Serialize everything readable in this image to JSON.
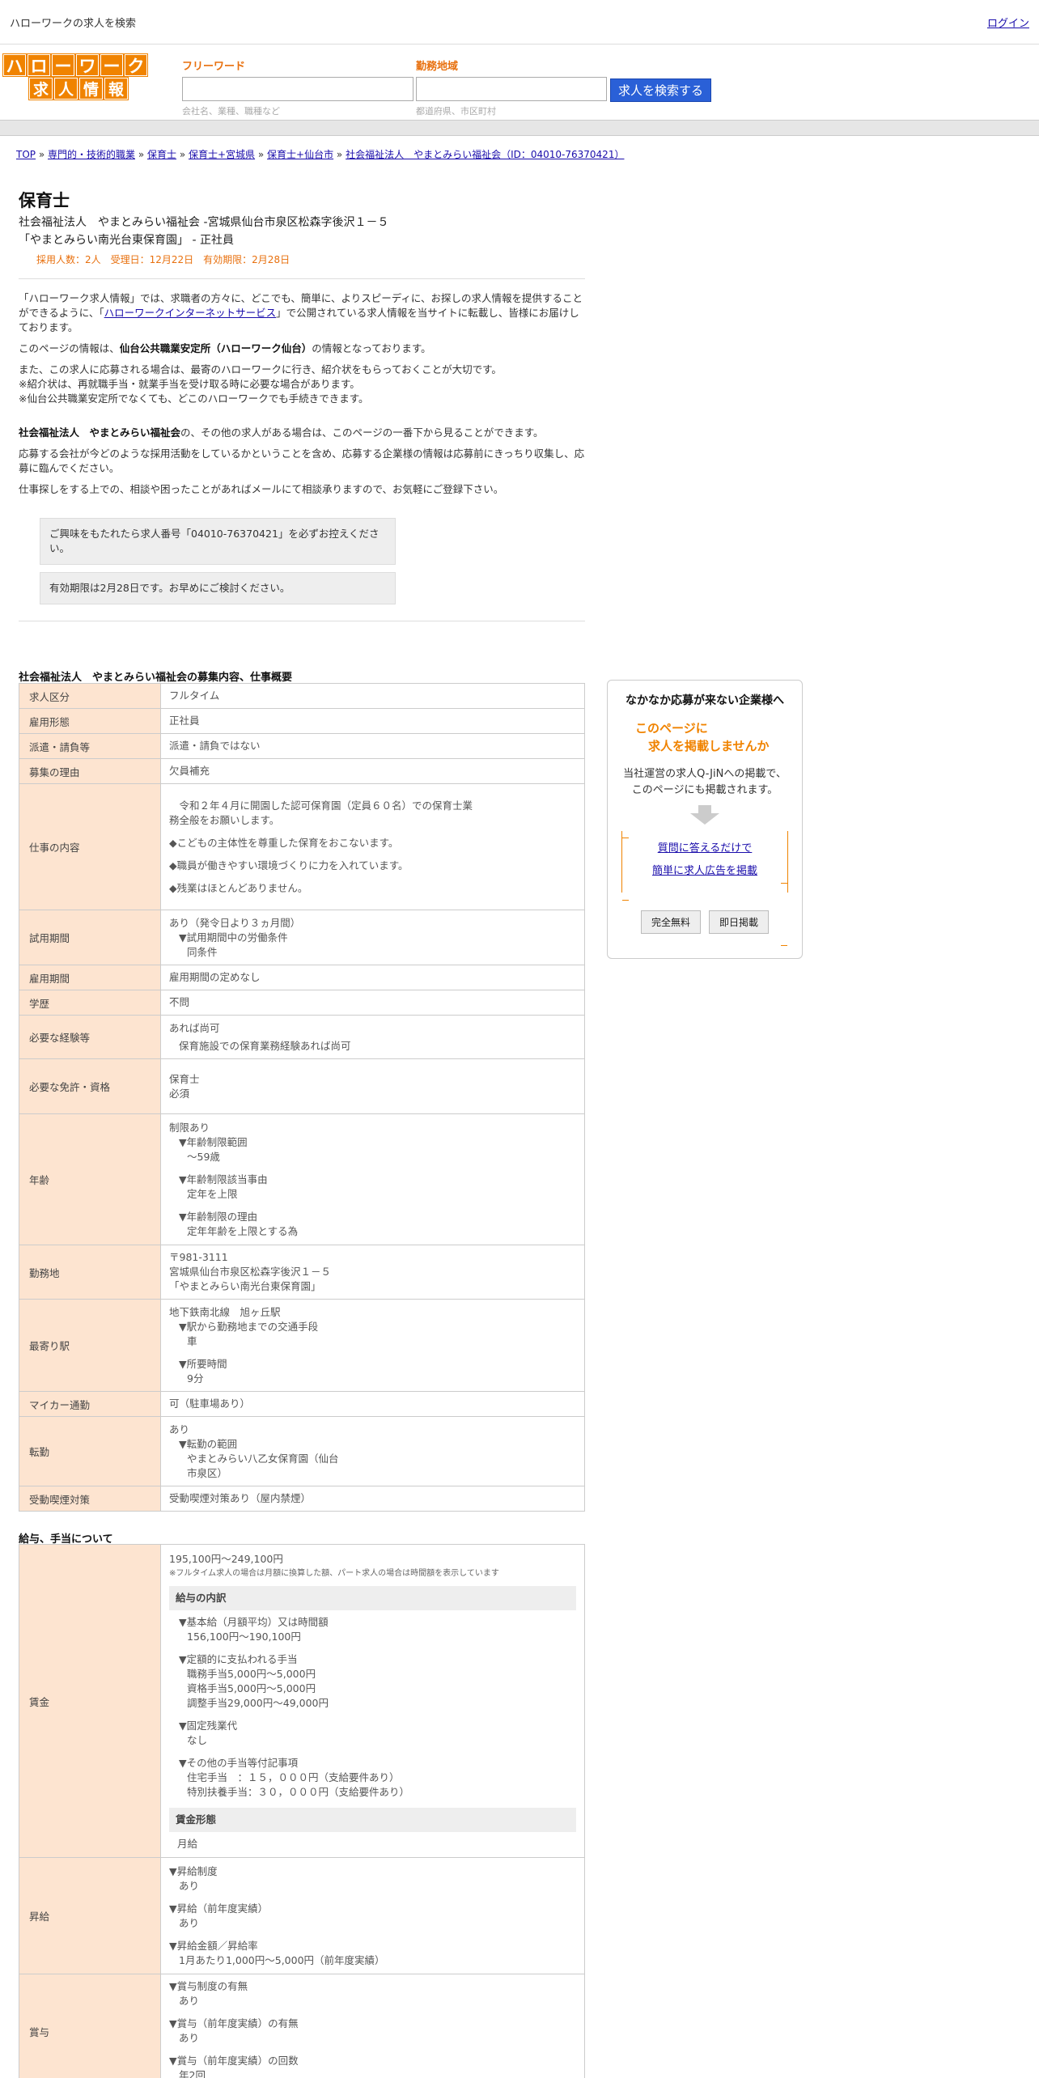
{
  "topbar": {
    "site_label": "ハローワークの求人を検索",
    "login": "ログイン"
  },
  "logo": {
    "row1": [
      "ハ",
      "ロ",
      "ー",
      "ワ",
      "ー",
      "ク"
    ],
    "row2": [
      "求",
      "人",
      "情",
      "報"
    ]
  },
  "search": {
    "keyword_label": "フリーワード",
    "keyword_hint": "会社名、業種、職種など",
    "area_label": "勤務地域",
    "area_hint": "都道府県、市区町村",
    "button": "求人を検索する"
  },
  "breadcrumb": [
    "TOP",
    "専門的・技術的職業",
    "保育士",
    "保育士+宮城県",
    "保育士+仙台市",
    "社会福祉法人　やまとみらい福祉会（ID：04010-76370421）"
  ],
  "job": {
    "title": "保育士",
    "company_line": "社会福祉法人　やまとみらい福祉会 -宮城県仙台市泉区松森字後沢１－５",
    "workplace_line": "「やまとみらい南光台東保育園」 - 正社員",
    "meta": "採用人数：2人　受理日：12月22日　有効期限：2月28日"
  },
  "intro": {
    "p1_a": "「ハローワーク求人情報」では、求職者の方々に、どこでも、簡単に、よりスピーディに、お探しの求人情報を提供することができるように、「",
    "p1_link": "ハローワークインターネットサービス",
    "p1_b": "」で公開されている求人情報を当サイトに転載し、皆様にお届けしております。",
    "p2_a": "このページの情報は、",
    "p2_bold": "仙台公共職業安定所（ハローワーク仙台）",
    "p2_b": "の情報となっております。",
    "p3_1": "また、この求人に応募される場合は、最寄のハローワークに行き、紹介状をもらっておくことが大切です。",
    "p3_2": "※紹介状は、再就職手当・就業手当を受け取る時に必要な場合があります。",
    "p3_3": "※仙台公共職業安定所でなくても、どこのハローワークでも手続きできます。",
    "p4_bold": "社会福祉法人　やまとみらい福祉会",
    "p4_b": "の、その他の求人がある場合は、このページの一番下から見ることができます。",
    "p5": "応募する会社が今どのような採用活動をしているかということを含め、応募する企業様の情報は応募前にきっちり収集し、応募に臨んでください。",
    "p6": "仕事探しをする上での、相談や困ったことがあればメールにて相談承りますので、お気軽にご登録下さい。",
    "note1": "ご興味をもたれたら求人番号「04010-76370421」を必ずお控えください。",
    "note2": "有効期限は2月28日です。お早めにご検討ください。"
  },
  "section_title": "社会福祉法人　やまとみらい福祉会の募集内容、仕事概要",
  "table": {
    "kyujin_kubun": {
      "label": "求人区分",
      "value": "フルタイム"
    },
    "koyo_keitai": {
      "label": "雇用形態",
      "value": "正社員"
    },
    "haken": {
      "label": "派遣・請負等",
      "value": "派遣・請負ではない"
    },
    "riyu": {
      "label": "募集の理由",
      "value": "欠員補充"
    },
    "shigoto": {
      "label": "仕事の内容",
      "l1": "　令和２年４月に開園した認可保育園（定員６０名）での保育士業",
      "l2": "務全般をお願いします。",
      "l3": "◆こどもの主体性を尊重した保育をおこないます。",
      "l4": "◆職員が働きやすい環境づくりに力を入れています。",
      "l5": "◆残業はほとんどありません。"
    },
    "shiyo": {
      "label": "試用期間",
      "l1": "あり（発令日より３ヵ月間）",
      "l2": "▼試用期間中の労働条件",
      "l3": "同条件"
    },
    "koyo_kikan": {
      "label": "雇用期間",
      "value": "雇用期間の定めなし"
    },
    "gakureki": {
      "label": "学歴",
      "value": "不問"
    },
    "keiken": {
      "label": "必要な経験等",
      "l1": "あれば尚可",
      "l2": "保育施設での保育業務経験あれば尚可"
    },
    "menkyo": {
      "label": "必要な免許・資格",
      "l1": "保育士",
      "l2": "必須"
    },
    "nenrei": {
      "label": "年齢",
      "l1": "制限あり",
      "l2": "▼年齢制限範囲",
      "l3": "〜59歳",
      "l4": "▼年齢制限該当事由",
      "l5": "定年を上限",
      "l6": "▼年齢制限の理由",
      "l7": "定年年齢を上限とする為"
    },
    "kinmuchi": {
      "label": "勤務地",
      "l1": "〒981-3111",
      "l2": "宮城県仙台市泉区松森字後沢１－５",
      "l3": "「やまとみらい南光台東保育園」"
    },
    "eki": {
      "label": "最寄り駅",
      "l1": "地下鉄南北線　旭ヶ丘駅",
      "l2": "▼駅から勤務地までの交通手段",
      "l3": "車",
      "l4": "▼所要時間",
      "l5": "9分"
    },
    "mycar": {
      "label": "マイカー通勤",
      "value": "可（駐車場あり）"
    },
    "tenkin": {
      "label": "転勤",
      "l1": "あり",
      "l2": "▼転勤の範囲",
      "l3": "やまとみらい八乙女保育園（仙台",
      "l4": "市泉区）"
    },
    "kitsuen": {
      "label": "受動喫煙対策",
      "value": "受動喫煙対策あり（屋内禁煙）"
    }
  },
  "salary": {
    "title": "給与、手当について",
    "chingin": {
      "label": "賃金",
      "range": "195,100円〜249,100円",
      "note": "※フルタイム求人の場合は月額に換算した額、パート求人の場合は時間額を表示しています",
      "sub1": "給与の内訳",
      "k1": "▼基本給（月額平均）又は時間額",
      "k1v": "156,100円〜190,100円",
      "k2": "▼定額的に支払われる手当",
      "k2v1": "職務手当5,000円〜5,000円",
      "k2v2": "資格手当5,000円〜5,000円",
      "k2v3": "調整手当29,000円〜49,000円",
      "k3": "▼固定残業代",
      "k3v": "なし",
      "k4": "▼その他の手当等付記事項",
      "k4v1": "住宅手当　：１５，０００円（支給要件あり）",
      "k4v2": "特別扶養手当：３０，０００円（支給要件あり）",
      "sub2": "賃金形態",
      "keitai": "月給"
    },
    "shokyu": {
      "label": "昇給",
      "l1": "▼昇給制度",
      "l2": "あり",
      "l3": "▼昇給（前年度実績）",
      "l4": "あり",
      "l5": "▼昇給金額／昇給率",
      "l6": "1月あたり1,000円〜5,000円（前年度実績）"
    },
    "shoyo": {
      "label": "賞与",
      "l1": "▼賞与制度の有無",
      "l2": "あり",
      "l3": "▼賞与（前年度実績）の有無",
      "l4": "あり",
      "l5": "▼賞与（前年度実績）の回数",
      "l6": "年2回"
    }
  },
  "ad": {
    "title": "なかなか応募が来ない企業様へ",
    "head1": "このページに",
    "head2": "求人を掲載しませんか",
    "text1": "当社運営の求人Q-JiNへの掲載で、",
    "text2": "このページにも掲載されます。",
    "link1": "質問に答えるだけで",
    "link2": "簡単に求人広告を掲載",
    "btn1": "完全無料",
    "btn2": "即日掲載",
    "accent": "#f08300"
  }
}
